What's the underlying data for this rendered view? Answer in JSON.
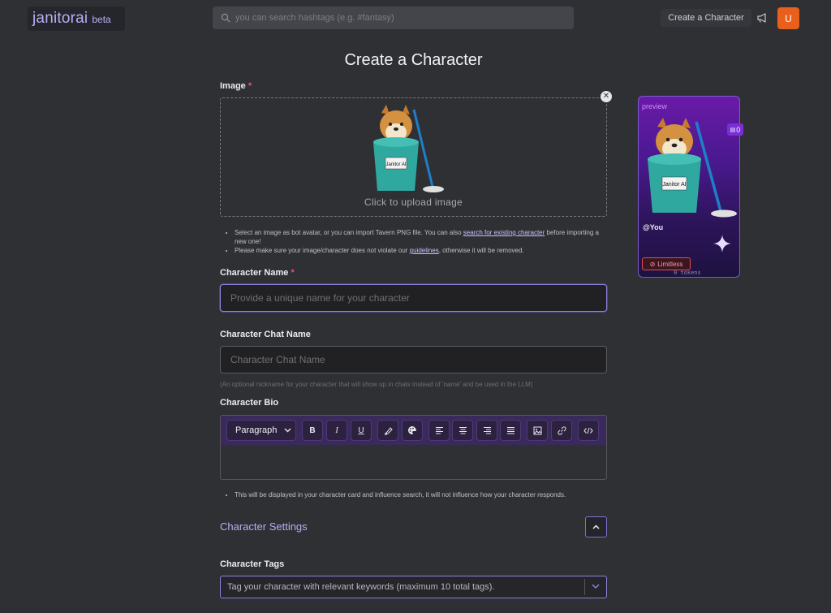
{
  "header": {
    "logo_text": "janitorai",
    "logo_beta": "beta",
    "search_placeholder": "you can search hashtags (e.g. #fantasy)",
    "create_label": "Create a Character",
    "avatar_letter": "U"
  },
  "page": {
    "title": "Create a Character"
  },
  "image_section": {
    "label": "Image",
    "required_mark": "*",
    "upload_text": "Click to upload image",
    "bucket_label": "Janitor AI",
    "hint1_prefix": "Select an image as bot avatar, or you can import Tavern PNG file. You can also ",
    "hint1_link": "search for existing character",
    "hint1_suffix": " before importing a new one!",
    "hint2_prefix": "Please make sure your image/character does not violate our ",
    "hint2_link": "guidelines",
    "hint2_suffix": ", otherwise it will be removed."
  },
  "name_section": {
    "label": "Character Name",
    "required_mark": "*",
    "placeholder": "Provide a unique name for your character"
  },
  "chat_name_section": {
    "label": "Character Chat Name",
    "placeholder": "Character Chat Name",
    "note": "(An optional nickname for your character that will show up in chats instead of 'name' and be used in the LLM)"
  },
  "bio_section": {
    "label": "Character Bio",
    "paragraph_select": "Paragraph",
    "toolbar": [
      "B",
      "I",
      "U"
    ],
    "hint": "This will be displayed in your character card and influence search, it will not influence how your character responds."
  },
  "settings": {
    "title": "Character Settings"
  },
  "tags_section": {
    "label": "Character Tags",
    "placeholder": "Tag your character with relevant keywords (maximum 10 total tags)."
  },
  "preview": {
    "tag": "preview",
    "badge_count": "0",
    "bucket_label": "Janitor AI",
    "user": "@You",
    "limitless": "Limitless",
    "tokens": "0 tokens"
  },
  "colors": {
    "accent": "#b7aef5",
    "background": "#2f3034",
    "toolbar": "#3a2a5c",
    "avatar": "#e8601c"
  }
}
